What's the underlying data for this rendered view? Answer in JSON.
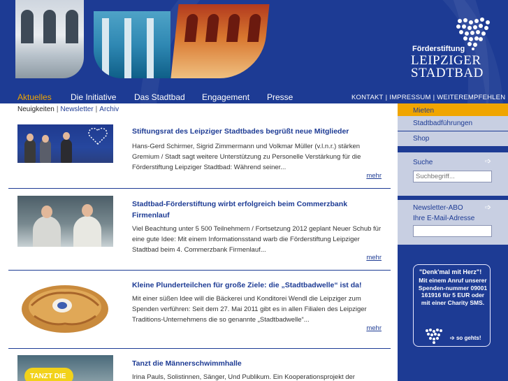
{
  "header": {
    "logo": {
      "line1": "Förderstiftung",
      "line2": "LEIPZIGER",
      "line3": "STADTBAD"
    }
  },
  "mainnav": {
    "items": [
      {
        "label": "Aktuelles",
        "active": true
      },
      {
        "label": "Die Initiative"
      },
      {
        "label": "Das Stadtbad"
      },
      {
        "label": "Engagement"
      },
      {
        "label": "Presse"
      }
    ],
    "meta": [
      "KONTAKT",
      "IMPRESSUM",
      "WEITEREMPFEHLEN"
    ]
  },
  "subnav": {
    "items": [
      "Neuigkeiten",
      "Newsletter",
      "Archiv"
    ]
  },
  "news": [
    {
      "title": "Stiftungsrat des Leipziger Stadtbades begrüßt neue Mitglieder",
      "text": "Hans-Gerd Schirmer, Sigrid Zimmermann und Volkmar Müller (v.l.n.r.) stärken Gremium / Stadt sagt weitere Unterstützung zu Personelle Verstärkung für die Förderstiftung Leipziger Stadtbad: Während seiner...",
      "more": "mehr"
    },
    {
      "title": "Stadtbad-Förderstiftung wirbt erfolgreich beim Commerzbank Firmenlauf",
      "text": "Viel Beachtung unter 5 500 Teilnehmern / Fortsetzung 2012 geplant Neuer Schub für eine gute Idee: Mit einem Informationsstand warb die Förderstiftung Leipziger Stadtbad beim 4. Commerzbank Firmenlauf...",
      "more": "mehr"
    },
    {
      "title": "Kleine Plunderteilchen für große Ziele: die „Stadtbadwelle“ ist da!",
      "text": "Mit einer süßen Idee will die Bäckerei und Konditorei Wendl die Leipziger zum Spenden verführen: Seit dem 27. Mai 2011 gibt es in allen Filialen des Leipziger Traditions-Unternehmens die so genannte „Stadtbadwelle“...",
      "more": "mehr"
    },
    {
      "title": "Tanzt die Männerschwimmhalle",
      "text": "Irina Pauls, Solistinnen, Sänger, Und Publikum. Ein Kooperationsprojekt der",
      "thumb_text": "TANZT DIE"
    }
  ],
  "sidebar": {
    "items": [
      "Mieten",
      "Stadtbadführungen",
      "Shop"
    ],
    "search": {
      "label": "Suche",
      "placeholder": "Suchbegriff..."
    },
    "newsletter": {
      "label1": "Newsletter-ABO",
      "label2": "Ihre E-Mail-Adresse"
    },
    "promo": {
      "title": "\"Denk'mal mit Herz\"!",
      "body": "Mit einem Anruf unserer Spenden-nummer 09001 161916 für 5 EUR oder mit einer Charity SMS.",
      "cta": "so gehts!"
    }
  },
  "colors": {
    "brand_blue": "#1d3b94",
    "accent_orange": "#f0a500",
    "sidebar_light": "#c8cfe2"
  }
}
